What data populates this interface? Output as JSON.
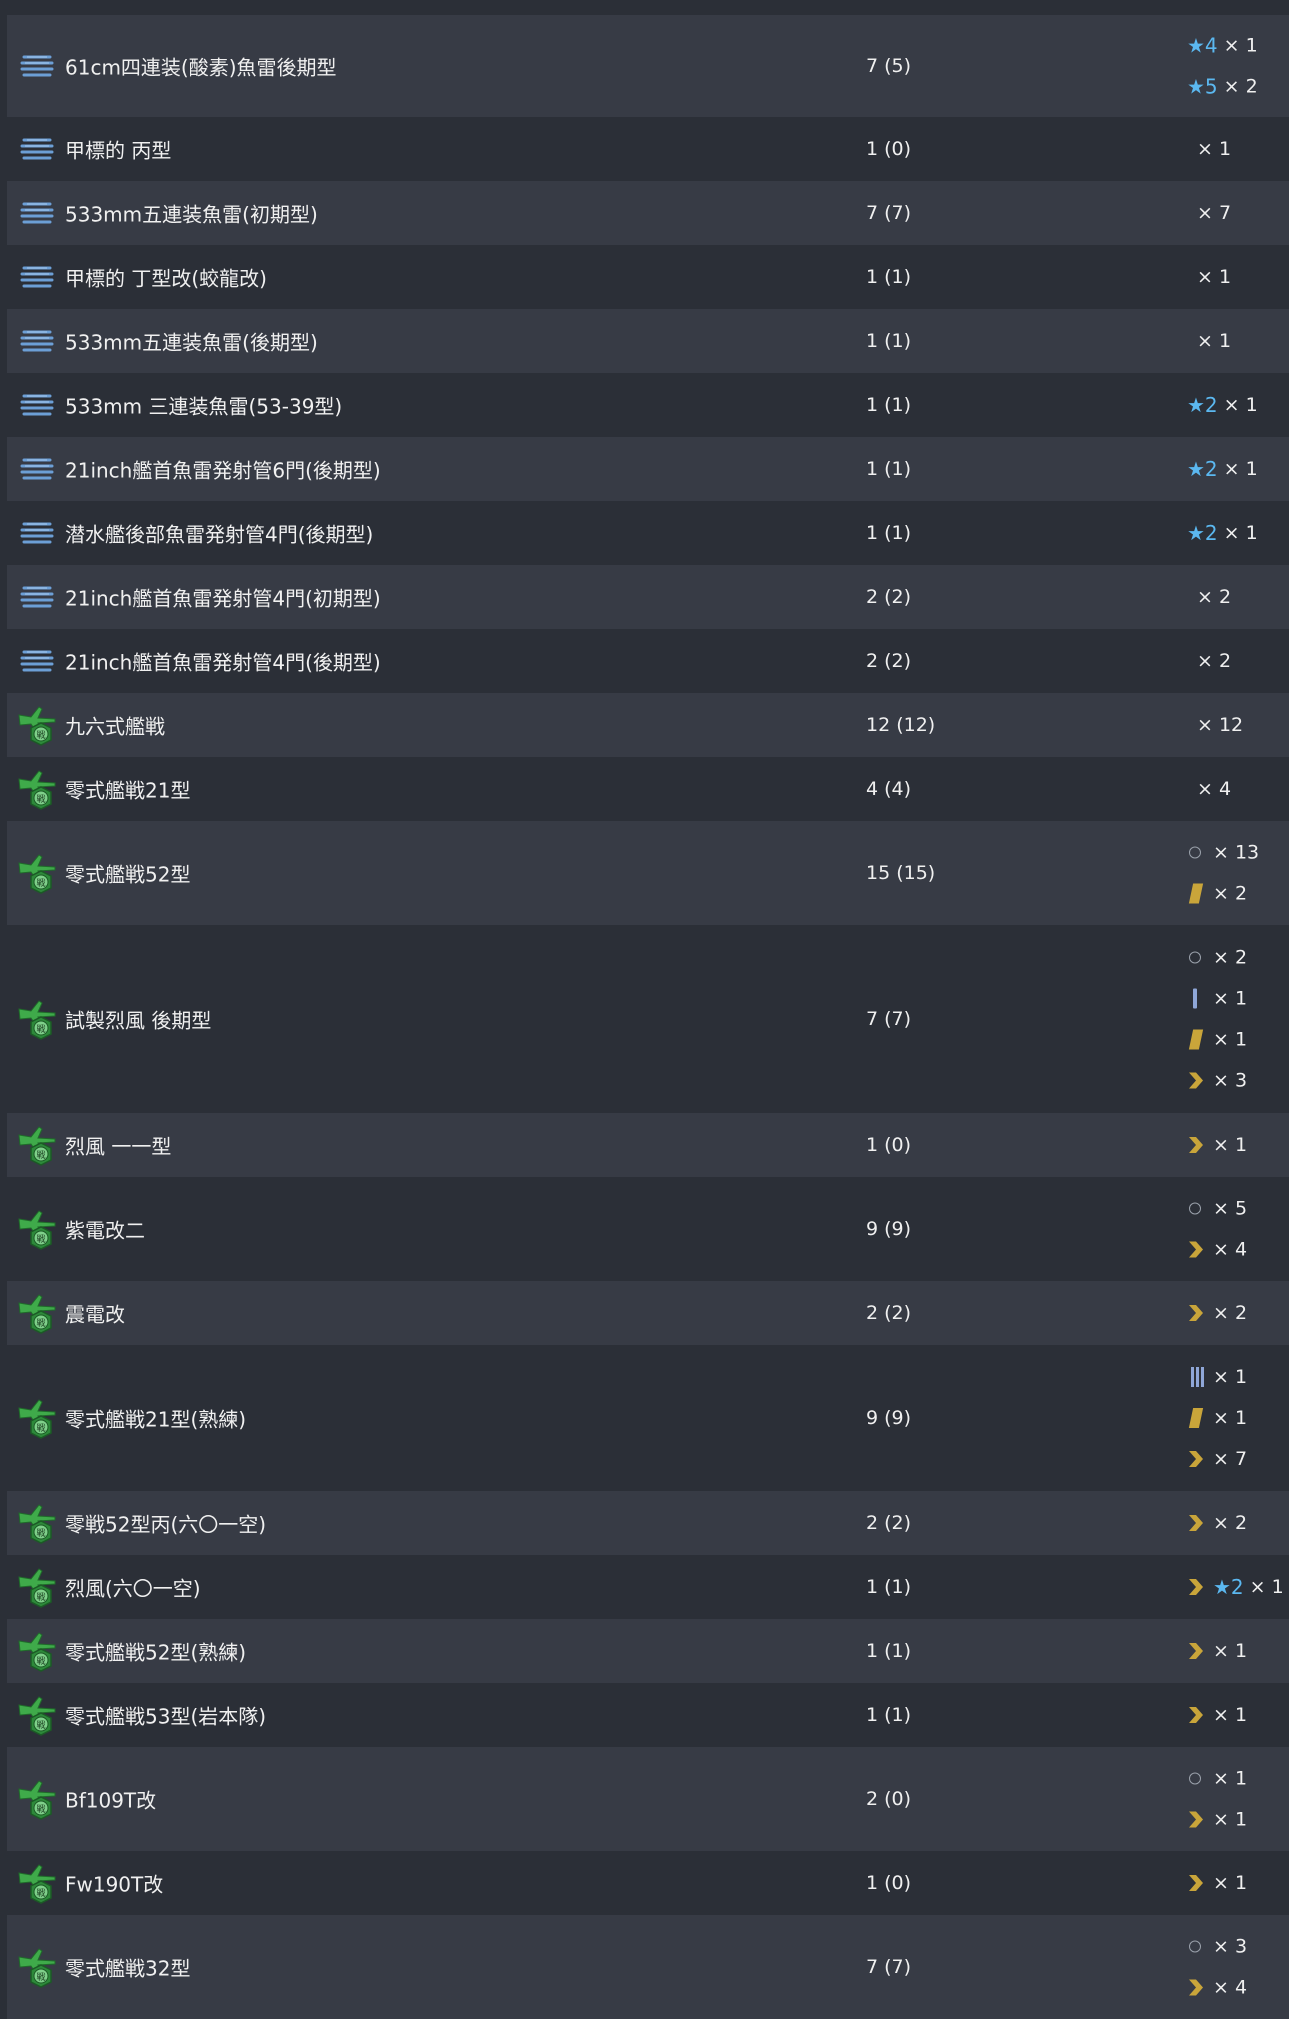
{
  "rows": [
    {
      "icon": "torpedo",
      "name": "61cm四連装(酸素)魚雷後期型",
      "count": "7 (5)",
      "height": 102,
      "mods": [
        {
          "sym": "star",
          "star": "★4",
          "text": "× 1"
        },
        {
          "sym": "star",
          "star": "★5",
          "text": "× 2"
        }
      ]
    },
    {
      "icon": "torpedo",
      "name": "甲標的 丙型",
      "count": "1 (0)",
      "height": 64,
      "mods": [
        {
          "sym": "none",
          "text": "× 1"
        }
      ]
    },
    {
      "icon": "torpedo",
      "name": "533mm五連装魚雷(初期型)",
      "count": "7 (7)",
      "height": 64,
      "mods": [
        {
          "sym": "none",
          "text": "× 7"
        }
      ]
    },
    {
      "icon": "torpedo",
      "name": "甲標的 丁型改(蛟龍改)",
      "count": "1 (1)",
      "height": 64,
      "mods": [
        {
          "sym": "none",
          "text": "× 1"
        }
      ]
    },
    {
      "icon": "torpedo",
      "name": "533mm五連装魚雷(後期型)",
      "count": "1 (1)",
      "height": 64,
      "mods": [
        {
          "sym": "none",
          "text": "× 1"
        }
      ]
    },
    {
      "icon": "torpedo",
      "name": "533mm 三連装魚雷(53-39型)",
      "count": "1 (1)",
      "height": 64,
      "mods": [
        {
          "sym": "star",
          "star": "★2",
          "text": "× 1"
        }
      ]
    },
    {
      "icon": "torpedo",
      "name": "21inch艦首魚雷発射管6門(後期型)",
      "count": "1 (1)",
      "height": 64,
      "mods": [
        {
          "sym": "star",
          "star": "★2",
          "text": "× 1"
        }
      ]
    },
    {
      "icon": "torpedo",
      "name": "潜水艦後部魚雷発射管4門(後期型)",
      "count": "1 (1)",
      "height": 64,
      "mods": [
        {
          "sym": "star",
          "star": "★2",
          "text": "× 1"
        }
      ]
    },
    {
      "icon": "torpedo",
      "name": "21inch艦首魚雷発射管4門(初期型)",
      "count": "2 (2)",
      "height": 64,
      "mods": [
        {
          "sym": "none",
          "text": "× 2"
        }
      ]
    },
    {
      "icon": "torpedo",
      "name": "21inch艦首魚雷発射管4門(後期型)",
      "count": "2 (2)",
      "height": 64,
      "mods": [
        {
          "sym": "none",
          "text": "× 2"
        }
      ]
    },
    {
      "icon": "fighter",
      "name": "九六式艦戦",
      "count": "12 (12)",
      "height": 64,
      "mods": [
        {
          "sym": "none",
          "text": "× 12"
        }
      ]
    },
    {
      "icon": "fighter",
      "name": "零式艦戦21型",
      "count": "4 (4)",
      "height": 64,
      "mods": [
        {
          "sym": "none",
          "text": "× 4"
        }
      ]
    },
    {
      "icon": "fighter",
      "name": "零式艦戦52型",
      "count": "15 (15)",
      "height": 104,
      "mods": [
        {
          "sym": "ring",
          "text": "× 13"
        },
        {
          "sym": "slash",
          "text": "× 2"
        }
      ]
    },
    {
      "icon": "fighter",
      "name": "試製烈風 後期型",
      "count": "7 (7)",
      "height": 188,
      "mods": [
        {
          "sym": "ring",
          "text": "× 2"
        },
        {
          "sym": "bar1",
          "text": "× 1"
        },
        {
          "sym": "slash",
          "text": "× 1"
        },
        {
          "sym": "chev",
          "text": "× 3"
        }
      ]
    },
    {
      "icon": "fighter",
      "name": "烈風 一一型",
      "count": "1 (0)",
      "height": 64,
      "mods": [
        {
          "sym": "chev",
          "text": "× 1"
        }
      ]
    },
    {
      "icon": "fighter",
      "name": "紫電改二",
      "count": "9 (9)",
      "height": 104,
      "mods": [
        {
          "sym": "ring",
          "text": "× 5"
        },
        {
          "sym": "chev",
          "text": "× 4"
        }
      ]
    },
    {
      "icon": "fighter",
      "name": "震電改",
      "count": "2 (2)",
      "height": 64,
      "mods": [
        {
          "sym": "chev",
          "text": "× 2"
        }
      ]
    },
    {
      "icon": "fighter",
      "name": "零式艦戦21型(熟練)",
      "count": "9 (9)",
      "height": 146,
      "mods": [
        {
          "sym": "bar3",
          "text": "× 1"
        },
        {
          "sym": "slash",
          "text": "× 1"
        },
        {
          "sym": "chev",
          "text": "× 7"
        }
      ]
    },
    {
      "icon": "fighter",
      "name": "零戦52型丙(六〇一空)",
      "count": "2 (2)",
      "height": 64,
      "mods": [
        {
          "sym": "chev",
          "text": "× 2"
        }
      ]
    },
    {
      "icon": "fighter",
      "name": "烈風(六〇一空)",
      "count": "1 (1)",
      "height": 64,
      "mods": [
        {
          "sym": "chev-star",
          "star": "★2",
          "text": "× 1"
        }
      ]
    },
    {
      "icon": "fighter",
      "name": "零式艦戦52型(熟練)",
      "count": "1 (1)",
      "height": 64,
      "mods": [
        {
          "sym": "chev",
          "text": "× 1"
        }
      ]
    },
    {
      "icon": "fighter",
      "name": "零式艦戦53型(岩本隊)",
      "count": "1 (1)",
      "height": 64,
      "mods": [
        {
          "sym": "chev",
          "text": "× 1"
        }
      ]
    },
    {
      "icon": "fighter",
      "name": "Bf109T改",
      "count": "2 (0)",
      "height": 104,
      "mods": [
        {
          "sym": "ring",
          "text": "× 1"
        },
        {
          "sym": "chev",
          "text": "× 1"
        }
      ]
    },
    {
      "icon": "fighter",
      "name": "Fw190T改",
      "count": "1 (0)",
      "height": 64,
      "mods": [
        {
          "sym": "chev",
          "text": "× 1"
        }
      ]
    },
    {
      "icon": "fighter",
      "name": "零式艦戦32型",
      "count": "7 (7)",
      "height": 104,
      "mods": [
        {
          "sym": "ring",
          "text": "× 3"
        },
        {
          "sym": "chev",
          "text": "× 4"
        }
      ]
    }
  ]
}
